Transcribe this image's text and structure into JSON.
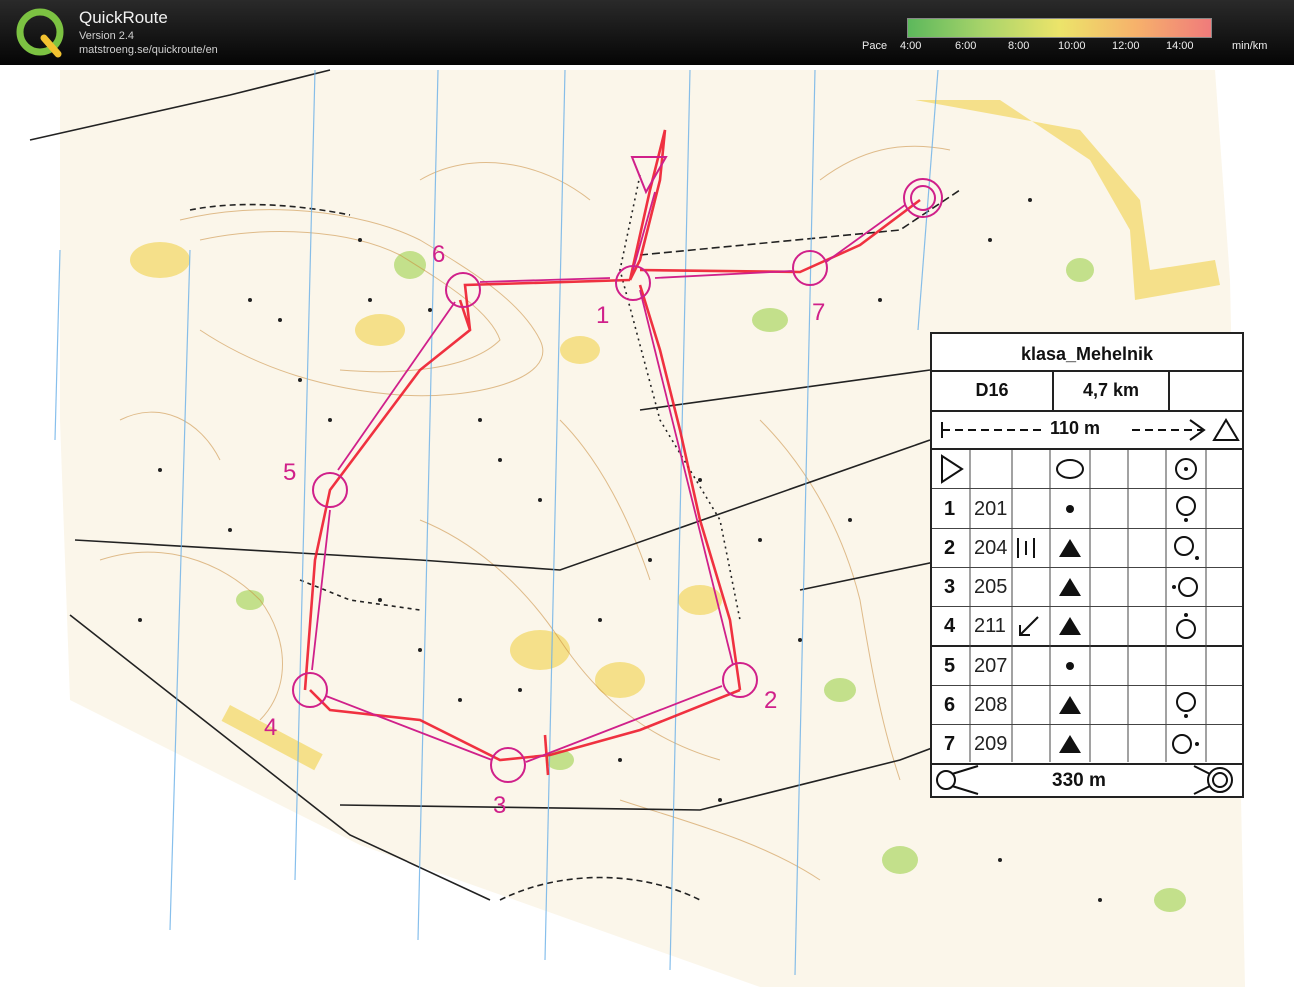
{
  "app": {
    "name": "QuickRoute",
    "version": "Version 2.4",
    "url": "matstroeng.se/quickroute/en"
  },
  "pace_legend": {
    "label": "Pace",
    "ticks": [
      "4:00",
      "6:00",
      "8:00",
      "10:00",
      "12:00",
      "14:00"
    ],
    "unit": "min/km",
    "colors": [
      "#5cb85c",
      "#a9d46a",
      "#ece46a",
      "#f6b26b",
      "#f07b7b"
    ]
  },
  "course": {
    "name": "klasa_Mehelnik",
    "category": "D16",
    "length": "4,7 km",
    "start_distance": "110 m",
    "finish_distance": "330 m",
    "controls": [
      {
        "number": "1",
        "code": "201",
        "feature": "dot"
      },
      {
        "number": "2",
        "code": "204",
        "feature": "triangle"
      },
      {
        "number": "3",
        "code": "205",
        "feature": "triangle"
      },
      {
        "number": "4",
        "code": "211",
        "feature": "triangle"
      },
      {
        "number": "5",
        "code": "207",
        "feature": "dot"
      },
      {
        "number": "6",
        "code": "208",
        "feature": "triangle"
      },
      {
        "number": "7",
        "code": "209",
        "feature": "triangle"
      }
    ]
  },
  "map_labels": {
    "c1": "1",
    "c2": "2",
    "c3": "3",
    "c4": "4",
    "c5": "5",
    "c6": "6",
    "c7": "7"
  },
  "colors": {
    "course": "#d0208a",
    "route": "#ee1c2e",
    "map_yellow": "#f3d96a",
    "map_green": "#b9dc7a",
    "contour": "#c88a3a",
    "grid_line": "#6ab0e8"
  }
}
